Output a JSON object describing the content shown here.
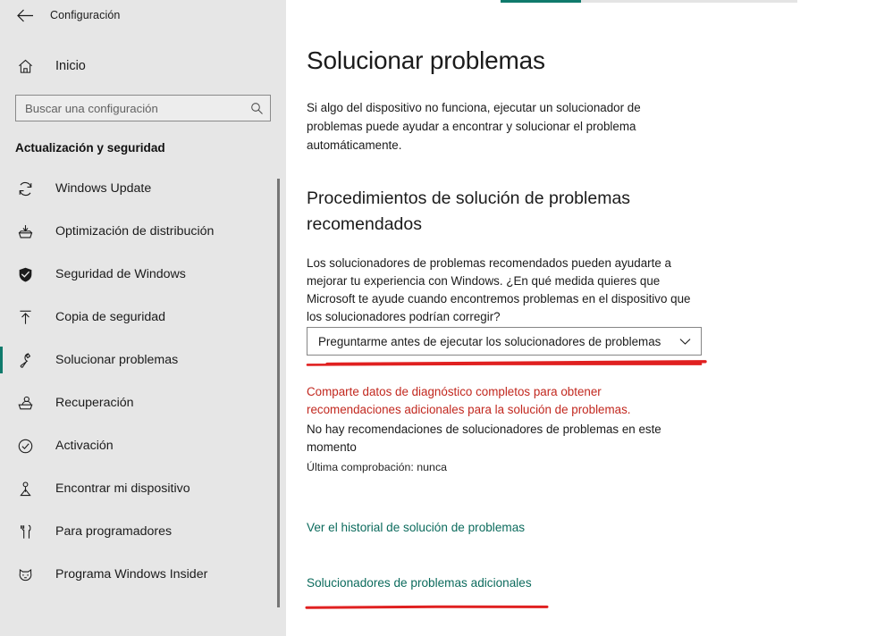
{
  "window": {
    "back_icon": "back-arrow-icon",
    "title": "Configuración"
  },
  "sidebar": {
    "home": {
      "label": "Inicio",
      "icon": "home-icon"
    },
    "search": {
      "placeholder": "Buscar una configuración",
      "value": "",
      "icon": "search-icon"
    },
    "group_title": "Actualización y seguridad",
    "accent_color": "#0f7a6c",
    "items": [
      {
        "label": "Windows Update",
        "icon": "refresh-icon",
        "selected": false
      },
      {
        "label": "Optimización de distribución",
        "icon": "delivery-optimization-icon",
        "selected": false
      },
      {
        "label": "Seguridad de Windows",
        "icon": "shield-icon",
        "selected": false
      },
      {
        "label": "Copia de seguridad",
        "icon": "upload-arrow-icon",
        "selected": false
      },
      {
        "label": "Solucionar problemas",
        "icon": "wrench-icon",
        "selected": true
      },
      {
        "label": "Recuperación",
        "icon": "recovery-icon",
        "selected": false
      },
      {
        "label": "Activación",
        "icon": "check-circle-icon",
        "selected": false
      },
      {
        "label": "Encontrar mi dispositivo",
        "icon": "find-device-icon",
        "selected": false
      },
      {
        "label": "Para programadores",
        "icon": "developer-tools-icon",
        "selected": false
      },
      {
        "label": "Programa Windows Insider",
        "icon": "insider-cat-icon",
        "selected": false
      }
    ]
  },
  "main": {
    "page_title": "Solucionar problemas",
    "intro": "Si algo del dispositivo no funciona, ejecutar un solucionador de problemas puede ayudar a encontrar y solucionar el problema automáticamente.",
    "section_title": "Procedimientos de solución de problemas recomendados",
    "section_desc": "Los solucionadores de problemas recomendados pueden ayudarte a mejorar tu experiencia con Windows. ¿En qué medida quieres que Microsoft te ayude cuando encontremos problemas en el dispositivo que los solucionadores podrían corregir?",
    "dropdown": {
      "selected": "Preguntarme antes de ejecutar los solucionadores de problemas",
      "chevron_icon": "chevron-down-icon"
    },
    "warning_text": "Comparte datos de diagnóstico completos para obtener recomendaciones adicionales para la solución de problemas.",
    "warning_color": "#c2281f",
    "no_recommendations": "No hay recomendaciones de solucionadores de problemas en este momento",
    "last_check": "Última comprobación: nunca",
    "links": [
      {
        "label": "Ver el historial de solución de problemas"
      },
      {
        "label": "Solucionadores de problemas adicionales"
      }
    ],
    "link_color": "#0c6b5d"
  },
  "annotations": {
    "color": "#e02020",
    "marks": [
      {
        "target": "dropdown-underline"
      },
      {
        "target": "additional-troubleshooters-underline"
      }
    ]
  }
}
